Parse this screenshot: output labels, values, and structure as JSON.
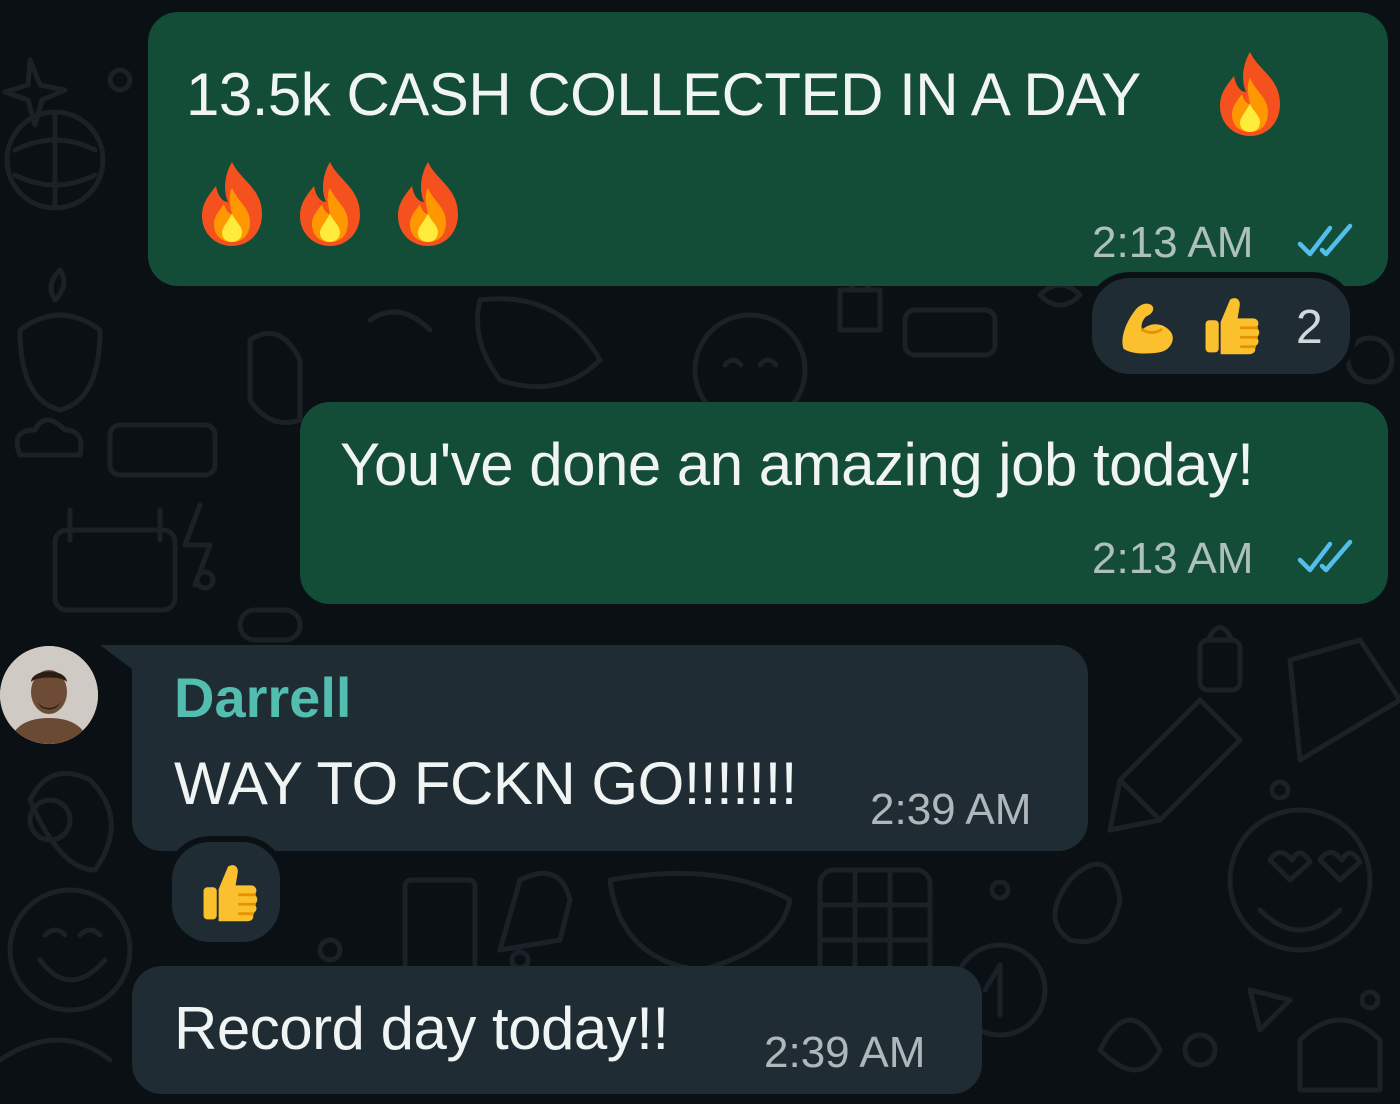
{
  "messages": [
    {
      "direction": "outgoing",
      "text": "13.5k CASH COLLECTED IN A DAY",
      "emoji": [
        "fire-emoji",
        "fire-emoji",
        "fire-emoji",
        "fire-emoji"
      ],
      "time": "2:13 AM",
      "status": "read",
      "reactions": {
        "emoji": [
          "flexed-biceps-emoji",
          "thumbs-up-emoji"
        ],
        "count": "2"
      }
    },
    {
      "direction": "outgoing",
      "text": "You've done an amazing job today!",
      "time": "2:13 AM",
      "status": "read"
    },
    {
      "direction": "incoming",
      "sender": "Darrell",
      "text": "WAY TO FCKN GO!!!!!!!",
      "time": "2:39 AM",
      "reactions": {
        "emoji": [
          "thumbs-up-emoji"
        ]
      }
    },
    {
      "direction": "incoming",
      "text": "Record day today!!",
      "time": "2:39 AM"
    }
  ],
  "colors": {
    "background": "#0b1014",
    "outgoing_bubble": "#144d37",
    "incoming_bubble": "#1f2c34",
    "sender_name": "#53bdb0",
    "read_ticks": "#53bdeb"
  }
}
